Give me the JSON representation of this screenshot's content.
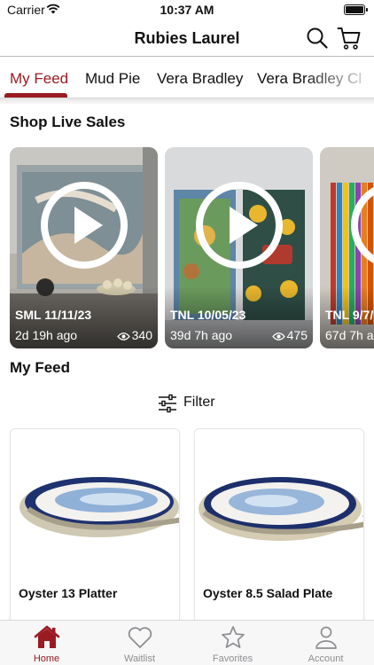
{
  "status": {
    "carrier": "Carrier",
    "time": "10:37 AM"
  },
  "header": {
    "title": "Rubies Laurel"
  },
  "tabs": [
    {
      "label": "My Feed"
    },
    {
      "label": "Mud Pie"
    },
    {
      "label": "Vera Bradley"
    },
    {
      "label": "Vera Bradley Cl"
    }
  ],
  "live": {
    "section_title": "Shop Live Sales",
    "cards": [
      {
        "name": "SML 11/11/23",
        "ago": "2d 19h ago",
        "views": "340"
      },
      {
        "name": "TNL 10/05/23",
        "ago": "39d 7h ago",
        "views": "475"
      },
      {
        "name": "TNL 9/7/",
        "ago": "67d 7h a",
        "views": ""
      }
    ]
  },
  "feed": {
    "section_title": "My Feed",
    "filter_label": "Filter",
    "products": [
      {
        "name": "Oyster 13 Platter"
      },
      {
        "name": "Oyster 8.5 Salad Plate"
      }
    ]
  },
  "tabbar": [
    {
      "label": "Home",
      "icon": "home-icon"
    },
    {
      "label": "Waitlist",
      "icon": "heart-icon"
    },
    {
      "label": "Favorites",
      "icon": "star-icon"
    },
    {
      "label": "Account",
      "icon": "person-icon"
    }
  ],
  "colors": {
    "accent": "#9b1b22",
    "inactive": "#8e8e93"
  }
}
